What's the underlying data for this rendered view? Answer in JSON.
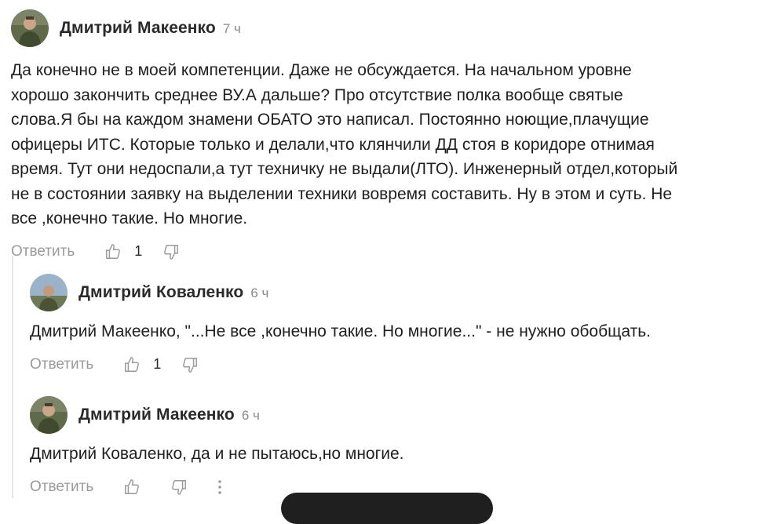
{
  "comments": [
    {
      "author": "Дмитрий Макеенко",
      "time": "7 ч",
      "lines": [
        "Да конечно не в моей компетенции. Даже не обсуждается. На начальном уровне",
        "хорошо закончить среднее ВУ.А дальше? Про отсутствие полка вообще святые",
        "слова.Я бы на каждом знамени ОБАТО это написал. Постоянно ноющие,плачущие",
        "офицеры ИТС. Которые только и делали,что клянчили ДД стоя в коридоре отнимая",
        "время. Тут они недоспали,а тут техничку не выдали(ЛТО). Инженерный отдел,который",
        "не в состоянии заявку на выделении техники вовремя составить. Ну в этом и суть. Не",
        "все ,конечно такие. Но многие."
      ],
      "reply_label": "Ответить",
      "likes": "1",
      "avatar_icon": "user-photo-avatar"
    },
    {
      "author": "Дмитрий Коваленко",
      "time": "6 ч",
      "lines": [
        "Дмитрий Макеенко, \"...Не все ,конечно такие. Но многие...\" - не нужно обобщать."
      ],
      "reply_label": "Ответить",
      "likes": "1",
      "avatar_icon": "user-photo-avatar"
    },
    {
      "author": "Дмитрий Макеенко",
      "time": "6 ч",
      "lines": [
        "Дмитрий Коваленко, да и не пытаюсь,но многие."
      ],
      "reply_label": "Ответить",
      "avatar_icon": "user-photo-avatar"
    }
  ],
  "icons": {
    "like": "thumbs-up-icon",
    "dislike": "thumbs-down-icon",
    "more": "more-vertical-icon"
  },
  "colors": {
    "text": "#1f1f1f",
    "muted": "#9a9a9a",
    "thread_line": "#e3e3e3"
  }
}
